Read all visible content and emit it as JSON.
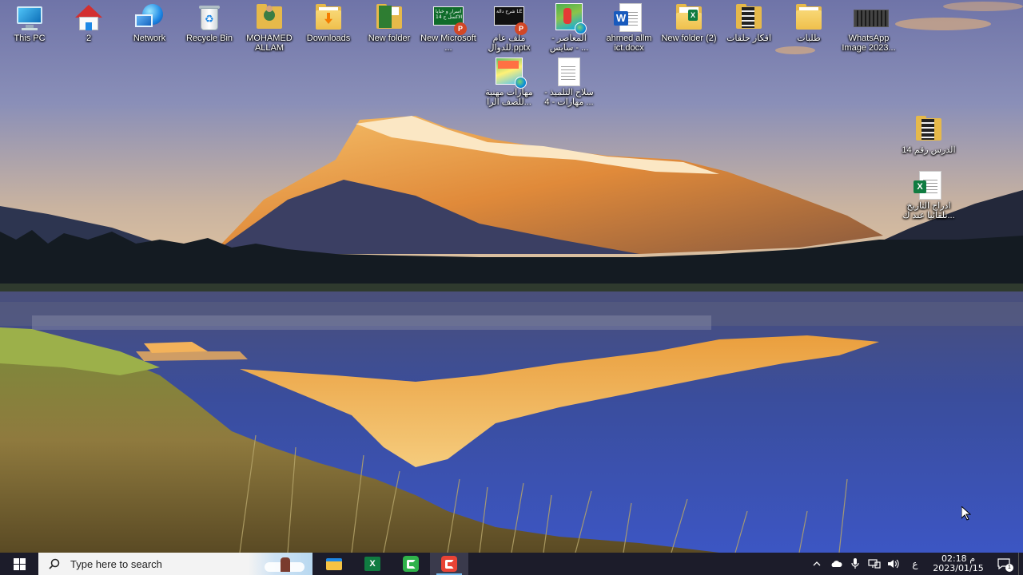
{
  "desktop": {
    "icons": [
      {
        "label": "This PC"
      },
      {
        "label": "2"
      },
      {
        "label": "Network"
      },
      {
        "label": "Recycle Bin"
      },
      {
        "label": "MOHAMED ALLAM"
      },
      {
        "label": "Downloads"
      },
      {
        "label": "New folder"
      },
      {
        "label": "New Microsoft ...",
        "thumb": "اسرار و خبايا الاكسل ح 14"
      },
      {
        "label": "ملف عام للدوال.pptx",
        "thumb": "شرح دالة LE"
      },
      {
        "label": "المعاصر - سايس - ..."
      },
      {
        "label": "ahmed allm ict.docx"
      },
      {
        "label": "New folder (2)"
      },
      {
        "label": "افكار حلقات"
      },
      {
        "label": "طلبات"
      },
      {
        "label": "WhatsApp Image 2023..."
      },
      {
        "label": "مهارات مهنية للصف الرا..."
      },
      {
        "label": "سلاح التلميذ - مهارات - 4 ..."
      },
      {
        "label": "الدرس رقم 14"
      },
      {
        "label": "ادراج التاريخ تلقائيا عند ك..."
      }
    ]
  },
  "taskbar": {
    "search_placeholder": "Type here to search",
    "apps": [
      {
        "name": "File Explorer",
        "active": false
      },
      {
        "name": "Excel",
        "active": false,
        "glyph": "X"
      },
      {
        "name": "Camtasia",
        "active": false
      },
      {
        "name": "Camtasia Recorder",
        "active": true
      }
    ],
    "tray": {
      "language": "ع",
      "time": "02:18 م",
      "date": "2023/01/15",
      "notification_count": "1"
    }
  },
  "colors": {
    "taskbar_bg": "#1c1c2a",
    "accent": "#76b9ed",
    "excel_green": "#107c41",
    "word_blue": "#185abd"
  }
}
